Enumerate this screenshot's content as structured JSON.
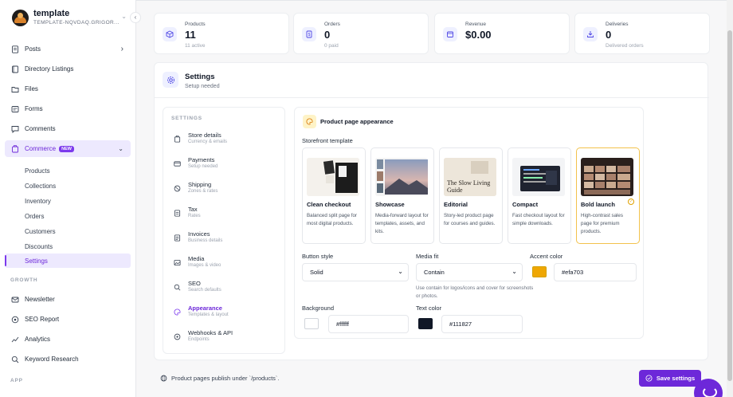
{
  "brand": {
    "name": "template",
    "subtitle": "TEMPLATE-NQVDAQ.GRIGOR..."
  },
  "sidebar": {
    "items": [
      {
        "label": "Posts",
        "icon": "file-text-icon"
      },
      {
        "label": "Directory Listings",
        "icon": "book-icon"
      },
      {
        "label": "Files",
        "icon": "folder-icon"
      },
      {
        "label": "Forms",
        "icon": "form-icon"
      },
      {
        "label": "Comments",
        "icon": "comment-icon"
      },
      {
        "label": "Commerce",
        "icon": "cart-icon",
        "badge": "NEW"
      }
    ],
    "commerce_sub": [
      "Products",
      "Collections",
      "Inventory",
      "Orders",
      "Customers",
      "Discounts",
      "Settings"
    ],
    "growth_label": "GROWTH",
    "growth_items": [
      {
        "label": "Newsletter",
        "icon": "mail-icon"
      },
      {
        "label": "SEO Report",
        "icon": "seo-icon"
      },
      {
        "label": "Analytics",
        "icon": "analytics-icon"
      },
      {
        "label": "Keyword Research",
        "icon": "search-icon"
      }
    ],
    "app_label": "APP"
  },
  "stats": [
    {
      "label": "Products",
      "value": "11",
      "sub": "11 active",
      "icon": "box-icon"
    },
    {
      "label": "Orders",
      "value": "0",
      "sub": "0 paid",
      "icon": "receipt-icon"
    },
    {
      "label": "Revenue",
      "value": "$0.00",
      "sub": "",
      "icon": "wallet-icon"
    },
    {
      "label": "Deliveries",
      "value": "0",
      "sub": "Delivered orders",
      "icon": "download-icon"
    }
  ],
  "settings": {
    "title": "Settings",
    "subtitle": "Setup needed",
    "nav_heading": "SETTINGS",
    "nav": [
      {
        "label": "Store details",
        "desc": "Currency & emails",
        "icon": "store-icon"
      },
      {
        "label": "Payments",
        "desc": "Setup needed",
        "icon": "card-icon"
      },
      {
        "label": "Shipping",
        "desc": "Zones & rates",
        "icon": "globe-icon"
      },
      {
        "label": "Tax",
        "desc": "Rates",
        "icon": "tax-icon"
      },
      {
        "label": "Invoices",
        "desc": "Business details",
        "icon": "invoice-icon"
      },
      {
        "label": "Media",
        "desc": "Images & video",
        "icon": "image-icon"
      },
      {
        "label": "SEO",
        "desc": "Search defaults",
        "icon": "search-icon"
      },
      {
        "label": "Appearance",
        "desc": "Templates & layout",
        "icon": "palette-icon"
      },
      {
        "label": "Webhooks & API",
        "desc": "Endpoints",
        "icon": "webhook-icon"
      }
    ],
    "appearance": {
      "title": "Product page appearance",
      "template_label": "Storefront template",
      "templates": [
        {
          "name": "Clean checkout",
          "desc": "Balanced split page for most digital products."
        },
        {
          "name": "Showcase",
          "desc": "Media-forward layout for templates, assets, and kits."
        },
        {
          "name": "Editorial",
          "desc": "Story-led product page for courses and guides.",
          "thumb_text": "The Slow Living Guide"
        },
        {
          "name": "Compact",
          "desc": "Fast checkout layout for simple downloads."
        },
        {
          "name": "Bold launch",
          "desc": "High-contrast sales page for premium products.",
          "selected": true
        }
      ],
      "button_style_label": "Button style",
      "button_style_value": "Solid",
      "media_fit_label": "Media fit",
      "media_fit_value": "Contain",
      "media_fit_help": "Use contain for logos/icons and cover for screenshots or photos.",
      "accent_label": "Accent color",
      "accent_value": "#efa703",
      "background_label": "Background",
      "background_value": "#ffffff",
      "text_color_label": "Text color",
      "text_color_value": "#111827"
    },
    "footer_note": "Product pages publish under `/products`.",
    "save_label": "Save settings"
  },
  "colors": {
    "accent": "#7c3aed",
    "swatch_accent": "#efa703",
    "swatch_bg": "#ffffff",
    "swatch_text": "#111827"
  }
}
